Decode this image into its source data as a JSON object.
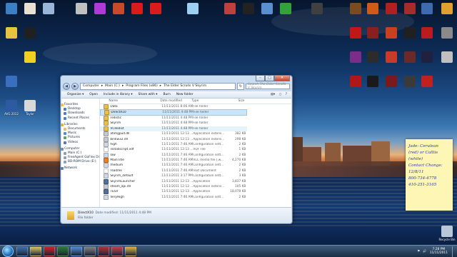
{
  "desktop": {
    "icons": [
      {
        "label": "",
        "color": "#3b7fc4"
      },
      {
        "label": "",
        "color": "#e8e1d2"
      },
      {
        "label": "",
        "color": "#9bb5d8"
      },
      {
        "label": "",
        "color": "#c0c0c0"
      },
      {
        "label": "",
        "color": "#b03ad8"
      },
      {
        "label": "",
        "color": "#c84a2a"
      },
      {
        "label": "",
        "color": "#d81c1c"
      },
      {
        "label": "",
        "color": "#d81c1c"
      },
      {
        "label": "",
        "color": "#9dd0f0"
      },
      {
        "label": "",
        "color": "#c04040"
      },
      {
        "label": "",
        "color": "#222222"
      },
      {
        "label": "",
        "color": "#5a8fd0"
      },
      {
        "label": "",
        "color": "#34a23a"
      },
      {
        "label": "",
        "color": "#404040"
      },
      {
        "label": "",
        "color": "#7a4a20"
      },
      {
        "label": "",
        "color": "#d05a1a"
      },
      {
        "label": "",
        "color": "#b02020"
      },
      {
        "label": "",
        "color": "#a62b2b"
      },
      {
        "label": "",
        "color": "#3e6bb0"
      },
      {
        "label": "",
        "color": "#e0a030"
      },
      {
        "label": "",
        "color": "#e8c340"
      },
      {
        "label": "",
        "color": "#f0d020"
      },
      {
        "label": "",
        "color": "#3a6fc0"
      },
      {
        "label": "AVG 2012",
        "color": "#2d5aa0"
      },
      {
        "label": "Taylor",
        "color": "#d9d9d9"
      },
      {
        "label": "",
        "color": "#c01818"
      },
      {
        "label": "",
        "color": "#8a1f1f"
      },
      {
        "label": "",
        "color": "#c84020"
      },
      {
        "label": "",
        "color": "#202020"
      },
      {
        "label": "",
        "color": "#b81c1c"
      },
      {
        "label": "",
        "color": "#7b2d8a"
      },
      {
        "label": "",
        "color": "#2c2c2c"
      },
      {
        "label": "",
        "color": "#c83a2a"
      },
      {
        "label": "",
        "color": "#6a2a2a"
      },
      {
        "label": "",
        "color": "#202040"
      },
      {
        "label": "",
        "color": "#b01818"
      },
      {
        "label": "",
        "color": "#1a1a1a"
      },
      {
        "label": "",
        "color": "#7a1a1a"
      },
      {
        "label": "",
        "color": "#3a3a3a"
      },
      {
        "label": "",
        "color": "#c02020"
      },
      {
        "label": "",
        "color": "#202020"
      },
      {
        "label": "",
        "color": "#8a8a8a"
      },
      {
        "label": "",
        "color": "#c0c0c0"
      },
      {
        "label": "Recycle Bin",
        "color": "#b8c8d8"
      }
    ]
  },
  "note": {
    "lines": [
      "Jade: Cerulean",
      "(red) or Calliis",
      "(white)",
      "Contact Change:",
      "12/8/11",
      "800-734-4778",
      "410-251-3165"
    ]
  },
  "window": {
    "breadcrumb": [
      "Computer",
      "Main (C:)",
      "Program Files (x86)",
      "The Elder Scrolls V Skyrim"
    ],
    "search_placeholder": "Search The Elder Scrolls V Skyrim",
    "toolbar": {
      "organize": "Organize ▾",
      "open": "Open",
      "include": "Include in library ▾",
      "share": "Share with ▾",
      "burn": "Burn",
      "newfolder": "New folder"
    },
    "columns": {
      "name": "Name",
      "date": "Date modified",
      "type": "Type",
      "size": "Size"
    },
    "nav": [
      {
        "label": "Favorites",
        "group": true,
        "color": "#f0c040"
      },
      {
        "label": "Desktop",
        "group": false,
        "color": "#4a7fc0"
      },
      {
        "label": "Downloads",
        "group": false,
        "color": "#4a7fc0"
      },
      {
        "label": "Recent Places",
        "group": false,
        "color": "#4a7fc0"
      },
      {
        "label": "Libraries",
        "group": true,
        "color": "#e0b040"
      },
      {
        "label": "Documents",
        "group": false,
        "color": "#e0c070"
      },
      {
        "label": "Music",
        "group": false,
        "color": "#4a90d0"
      },
      {
        "label": "Pictures",
        "group": false,
        "color": "#60a060"
      },
      {
        "label": "Videos",
        "group": false,
        "color": "#6070c0"
      },
      {
        "label": "Computer",
        "group": true,
        "color": "#7090b0"
      },
      {
        "label": "Main (C:)",
        "group": false,
        "color": "#8aa0b8"
      },
      {
        "label": "FreeAgent GoFlex Dr",
        "group": false,
        "color": "#8aa0b8"
      },
      {
        "label": "BD-ROM Drive (E:)",
        "group": false,
        "color": "#8aa0b8"
      },
      {
        "label": "Network",
        "group": true,
        "color": "#6080a0"
      }
    ],
    "files": [
      {
        "name": "Data",
        "date": "11/11/2011 8:06 AM",
        "type": "File folder",
        "size": "",
        "color": "#e8c050",
        "state": ""
      },
      {
        "name": "DirectX10",
        "date": "11/11/2011 4:48 PM",
        "type": "File folder",
        "size": "",
        "color": "#e8c050",
        "state": "sel"
      },
      {
        "name": "redistic",
        "date": "11/11/2011 4:48 PM",
        "type": "File folder",
        "size": "",
        "color": "#e8c050",
        "state": ""
      },
      {
        "name": "Skyrim",
        "date": "11/11/2011 4:48 PM",
        "type": "File folder",
        "size": "",
        "color": "#e8c050",
        "state": ""
      },
      {
        "name": "VCRedist",
        "date": "11/11/2011 4:48 PM",
        "type": "File folder",
        "size": "",
        "color": "#e8c050",
        "state": "hover"
      },
      {
        "name": "atimgpud.dll",
        "date": "11/11/2011 12:13 ...",
        "type": "Application extens...",
        "size": "382 KB",
        "color": "#c8c8d0",
        "state": ""
      },
      {
        "name": "binkw32.dll",
        "date": "11/11/2011 12:13 ...",
        "type": "Application extens...",
        "size": "298 KB",
        "color": "#c8c8d0",
        "state": ""
      },
      {
        "name": "high",
        "date": "11/11/2011 7:46 AM",
        "type": "Configuration sett...",
        "size": "2 KB",
        "color": "#d0d8e8",
        "state": ""
      },
      {
        "name": "installscript.vdf",
        "date": "11/11/2011 12:13 ...",
        "type": "VDF File",
        "size": "1 KB",
        "color": "#ffffff",
        "state": ""
      },
      {
        "name": "low",
        "date": "11/11/2011 7:46 AM",
        "type": "Configuration sett...",
        "size": "2 KB",
        "color": "#d0d8e8",
        "state": ""
      },
      {
        "name": "MainTitle",
        "date": "11/11/2011 7:46 AM",
        "type": "VLC media file (.w...",
        "size": "4,270 KB",
        "color": "#f08020",
        "state": ""
      },
      {
        "name": "medium",
        "date": "11/11/2011 7:46 AM",
        "type": "Configuration sett...",
        "size": "2 KB",
        "color": "#d0d8e8",
        "state": ""
      },
      {
        "name": "readme",
        "date": "11/11/2011 7:46 AM",
        "type": "Text Document",
        "size": "2 KB",
        "color": "#ffffff",
        "state": ""
      },
      {
        "name": "Skyrim_default",
        "date": "11/11/2011 3:17 PM",
        "type": "Configuration sett...",
        "size": "3 KB",
        "color": "#d0d8e8",
        "state": ""
      },
      {
        "name": "SkyrimLauncher",
        "date": "11/11/2011 12:13 ...",
        "type": "Application",
        "size": "3,837 KB",
        "color": "#5070a0",
        "state": ""
      },
      {
        "name": "steam_api.dll",
        "date": "11/11/2011 12:13 ...",
        "type": "Application extens...",
        "size": "105 KB",
        "color": "#c8c8d0",
        "state": ""
      },
      {
        "name": "TESV",
        "date": "11/11/2011 12:13 ...",
        "type": "Application",
        "size": "18,078 KB",
        "color": "#5070a0",
        "state": ""
      },
      {
        "name": "VeryHigh",
        "date": "11/11/2011 7:46 AM",
        "type": "Configuration sett...",
        "size": "2 KB",
        "color": "#d0d8e8",
        "state": ""
      }
    ],
    "details": {
      "name": "DirectX10",
      "modified": "Date modified: 11/11/2011 4:48 PM",
      "type": "File folder"
    }
  },
  "taskbar": {
    "apps": [
      {
        "color": "#3b6ea8"
      },
      {
        "color": "#e0c060"
      },
      {
        "color": "#d02020"
      },
      {
        "color": "#2a7a2a"
      },
      {
        "color": "#4b8ad8"
      },
      {
        "color": "#808080"
      },
      {
        "color": "#b03030"
      },
      {
        "color": "#c04040"
      },
      {
        "color": "#e0b040"
      }
    ],
    "time": "7:28 PM",
    "date": "11/11/2011"
  }
}
